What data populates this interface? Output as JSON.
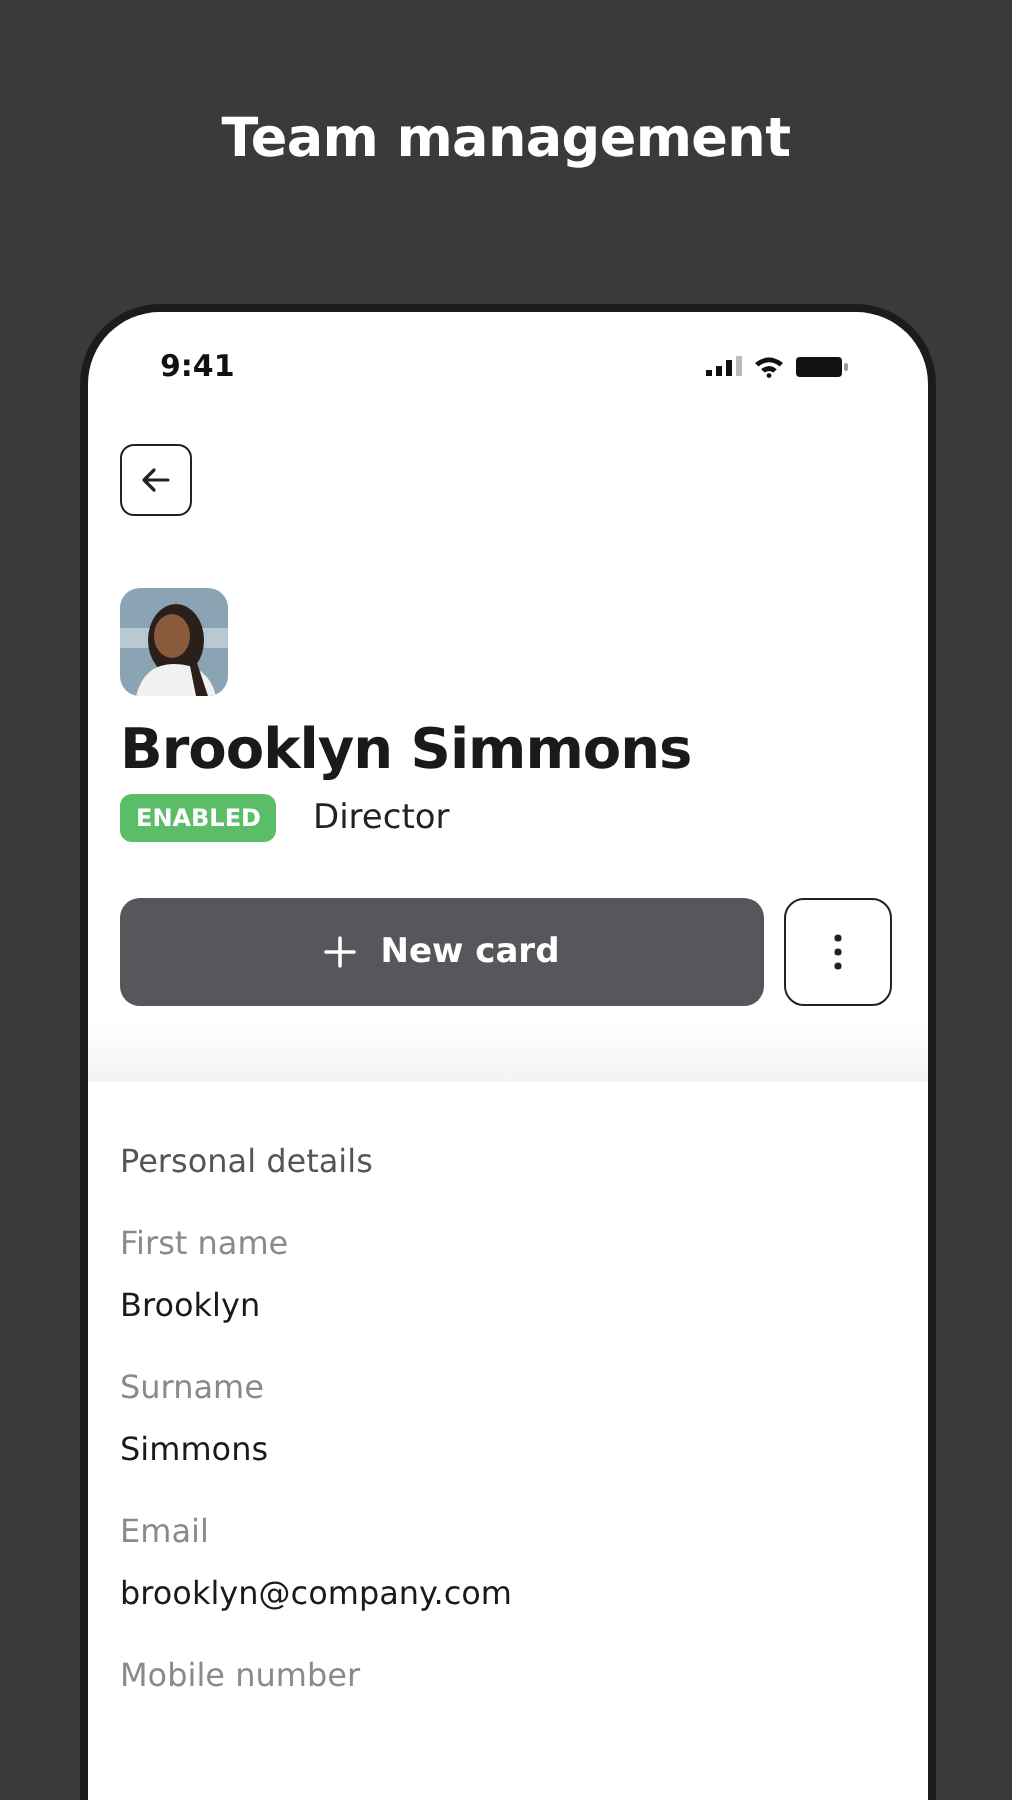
{
  "heading": "Team management",
  "status_bar": {
    "time": "9:41"
  },
  "profile": {
    "name": "Brooklyn Simmons",
    "status": {
      "label": "ENABLED",
      "kind": "enabled"
    },
    "role": "Director"
  },
  "primary_button": {
    "label": "New card"
  },
  "section": {
    "title": "Personal details",
    "fields": [
      {
        "label": "First name",
        "value": "Brooklyn"
      },
      {
        "label": "Surname",
        "value": "Simmons"
      },
      {
        "label": "Email",
        "value": "brooklyn@company.com"
      },
      {
        "label": "Mobile number"
      }
    ]
  }
}
